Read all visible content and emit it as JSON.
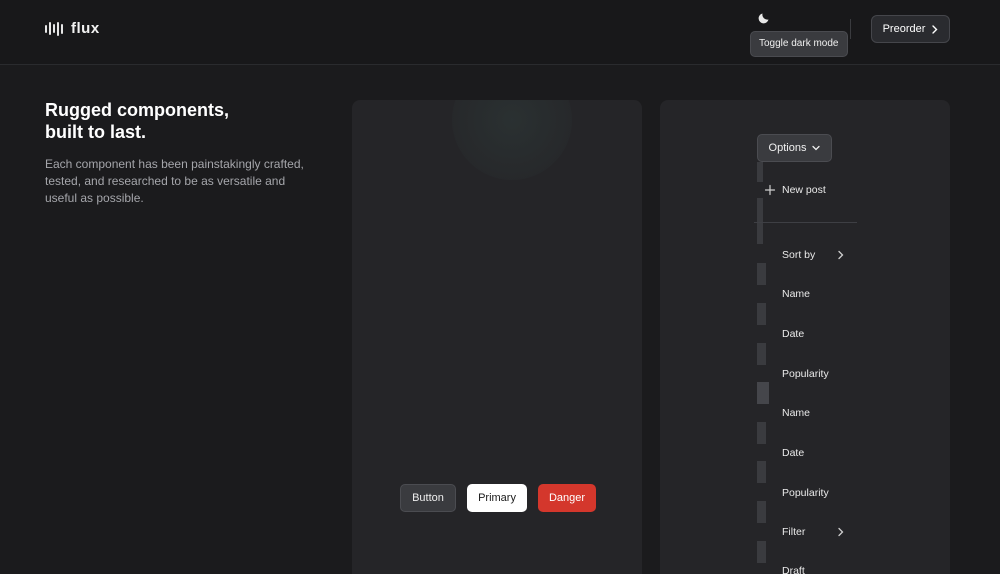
{
  "brand": {
    "name": "flux",
    "icon": "waveform-icon"
  },
  "header": {
    "theme_icon": "moon-icon",
    "theme_tooltip": "Toggle dark mode",
    "preorder_label": "Preorder"
  },
  "hero": {
    "title_line1": "Rugged components,",
    "title_line2": "built to last.",
    "description": "Each component has been painstakingly crafted, tested, and researched to be as versatile and useful as possible."
  },
  "buttons": {
    "default": "Button",
    "primary": "Primary",
    "danger": "Danger"
  },
  "dropdown": {
    "trigger_label": "Options",
    "new_post": "New post",
    "sort_by": "Sort by",
    "items": [
      "Name",
      "Date",
      "Popularity",
      "Name",
      "Date",
      "Popularity"
    ],
    "filter": "Filter",
    "draft": "Draft"
  },
  "colors": {
    "background": "#1b1b1d",
    "panel": "#252528",
    "danger": "#d4372c",
    "primary": "#ffffff"
  }
}
